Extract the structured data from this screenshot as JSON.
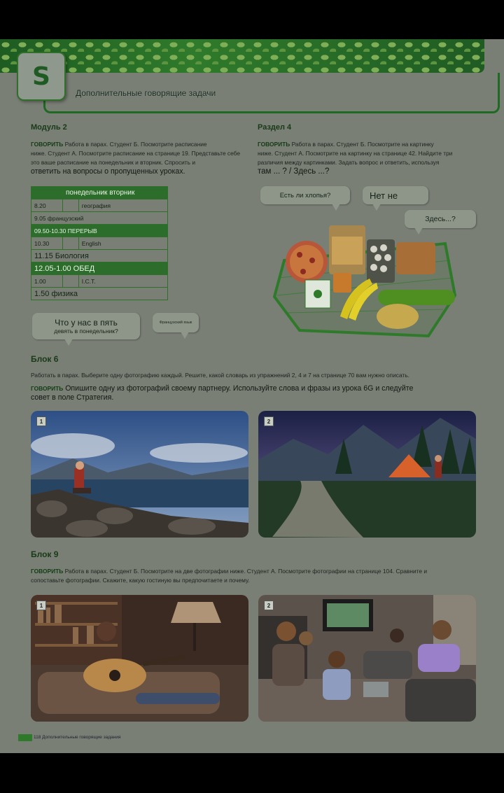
{
  "header": {
    "letter": "S",
    "title": "Дополнительные говорящие задачи"
  },
  "unit2": {
    "heading": "Модуль 2",
    "instruction_label": "ГОВОРИТЬ",
    "instruction_line1": " Работа в парах. Студент Б. Посмотрите расписание",
    "instruction_line2": "ниже. Студент А. Посмотрите расписание на странице 19. Представьте себе",
    "instruction_line3": "это ваше расписание на понедельник и вторник. Спросить и",
    "instruction_line4": "ответить на вопросы о пропущенных уроках.",
    "timetable": {
      "header": "понедельник вторник",
      "rows": [
        {
          "time": "8.20",
          "mon": "",
          "tue": "география",
          "type": "normal"
        },
        {
          "time": "9.05 французский",
          "mon": "",
          "tue": "",
          "type": "normal"
        },
        {
          "time": "09.50-10.30 ПЕРЕРЫВ",
          "mon": "",
          "tue": "",
          "type": "highlight"
        },
        {
          "time": "10.30",
          "mon": "",
          "tue": "English",
          "type": "normal"
        },
        {
          "time": "11.15 Биология",
          "mon": "",
          "tue": "",
          "type": "big"
        },
        {
          "time": "12.05-1.00 ОБЕД",
          "mon": "",
          "tue": "",
          "type": "highlight-big"
        },
        {
          "time": "1.00",
          "mon": "",
          "tue": "I.C.T.",
          "type": "normal"
        },
        {
          "time": "1.50 физика",
          "mon": "",
          "tue": "",
          "type": "big"
        }
      ]
    },
    "bubble1_line1": "Что у нас в пять",
    "bubble1_line2": "девять в понедельник?",
    "bubble2": "Французский язык"
  },
  "unit4": {
    "heading": "Раздел 4",
    "instruction_label": "ГОВОРИТЬ",
    "instruction_line1": " Работа в парах. Студент Б. Посмотрите на картинку",
    "instruction_line2": "ниже. Студент А. Посмотрите на картинку на странице 42. Найдите три",
    "instruction_line3": "различия между картинками. Задать вопрос и ответить, используя",
    "instruction_line4": "там ... ? / Здесь ...?",
    "bubble1": "Есть ли хлопья?",
    "bubble2": "Нет не",
    "bubble3": "Здесь...?"
  },
  "unit6": {
    "heading": "Блок 6",
    "line1": "Работать в парах. Выберите одну фотографию каждый. Решите, какой словарь из упражнений 2, 4 и 7 на странице 70 вам нужно описать.",
    "label": "ГОВОРИТЬ",
    "line2": " Опишите одну из фотографий своему партнеру. Используйте слова и фразы из урока 6G и следуйте",
    "line3": "совет в поле Стратегия.",
    "photo1_num": "1",
    "photo2_num": "2"
  },
  "unit9": {
    "heading": "Блок 9",
    "label": "ГОВОРИТЬ",
    "line1": " Работа в парах. Студент Б. Посмотрите на две фотографии ниже. Студент А. Посмотрите фотографии на странице 104. Сравните и",
    "line2": "сопоставьте фотографии. Скажите, какую гостиную вы предпочитаете и почему.",
    "photo1_num": "1",
    "photo2_num": "2"
  },
  "footer": {
    "text": "118 Дополнительные говорящие задания"
  }
}
